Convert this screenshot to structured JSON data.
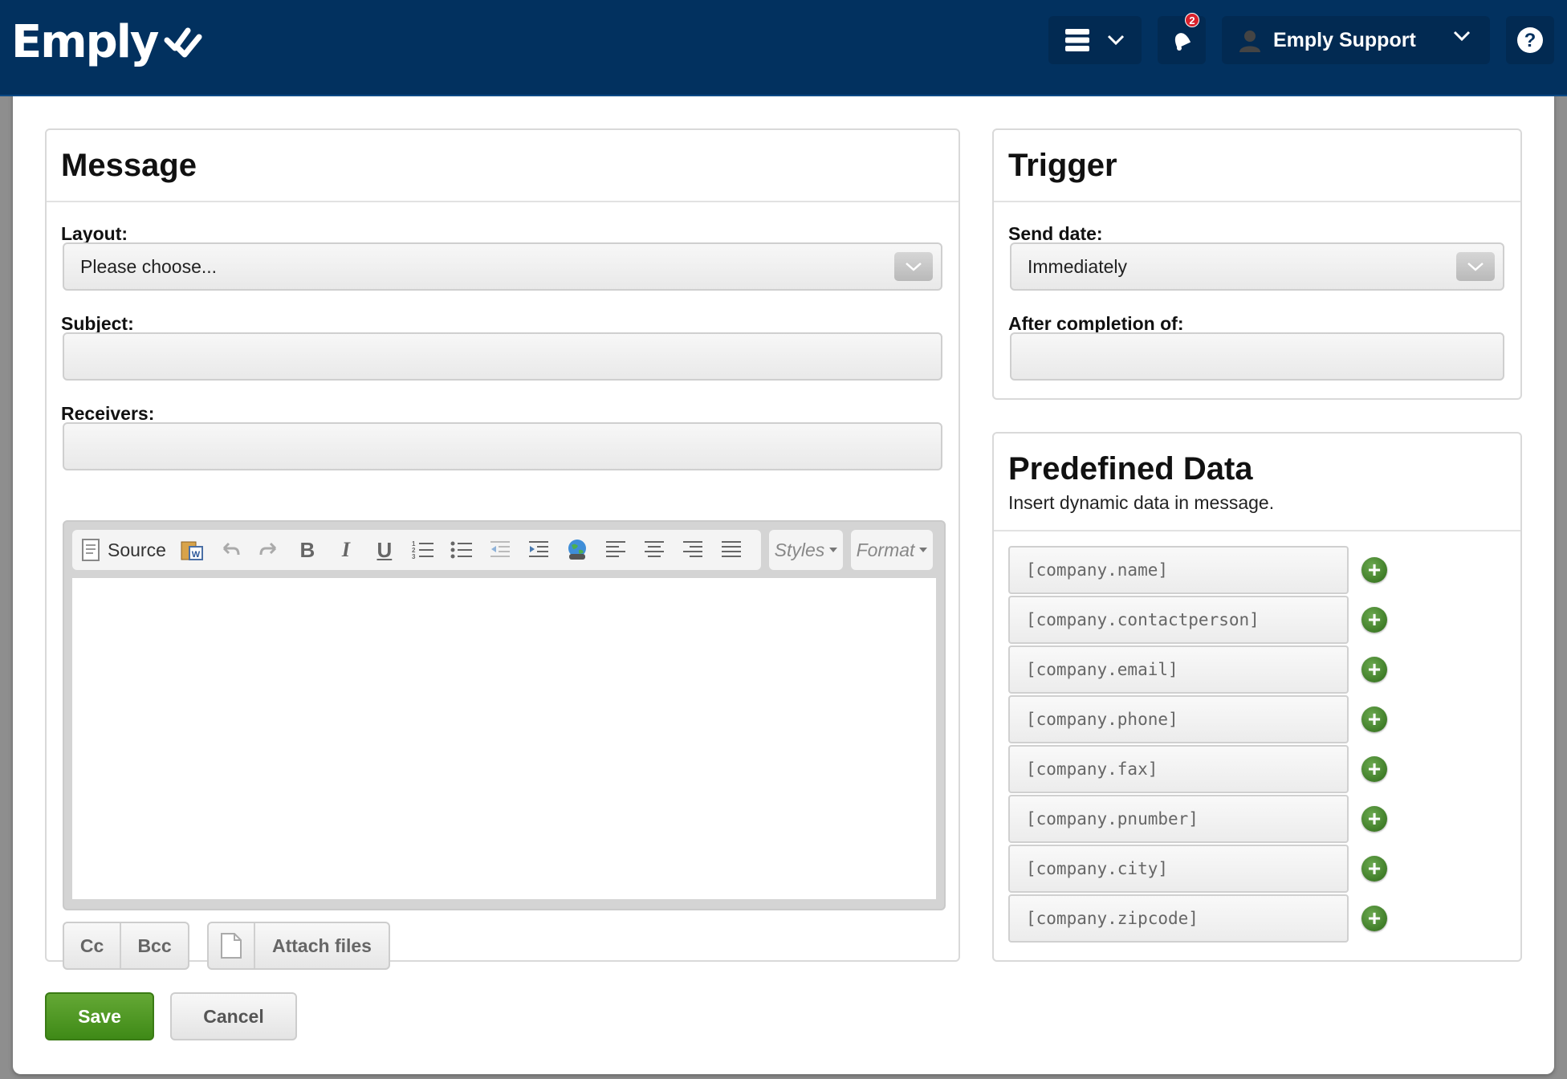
{
  "header": {
    "logo_text": "Emply",
    "notification_count": "2",
    "user_name": "Emply Support"
  },
  "message": {
    "title": "Message",
    "layout_label": "Layout:",
    "layout_value": "Please choose...",
    "subject_label": "Subject:",
    "subject_value": "",
    "receivers_label": "Receivers:",
    "receivers_value": "",
    "toolbar": {
      "source_label": "Source",
      "styles_label": "Styles",
      "format_label": "Format"
    },
    "cc_label": "Cc",
    "bcc_label": "Bcc",
    "attach_label": "Attach files"
  },
  "trigger": {
    "title": "Trigger",
    "send_date_label": "Send date:",
    "send_date_value": "Immediately",
    "after_completion_label": "After completion of:",
    "after_completion_value": ""
  },
  "predefined": {
    "title": "Predefined Data",
    "subtitle": "Insert dynamic data in message.",
    "items": [
      "[company.name]",
      "[company.contactperson]",
      "[company.email]",
      "[company.phone]",
      "[company.fax]",
      "[company.pnumber]",
      "[company.city]",
      "[company.zipcode]"
    ]
  },
  "actions": {
    "save_label": "Save",
    "cancel_label": "Cancel"
  },
  "colors": {
    "header_bg": "#02315f",
    "save_green": "#4f9a24",
    "add_green": "#3d7d22"
  }
}
